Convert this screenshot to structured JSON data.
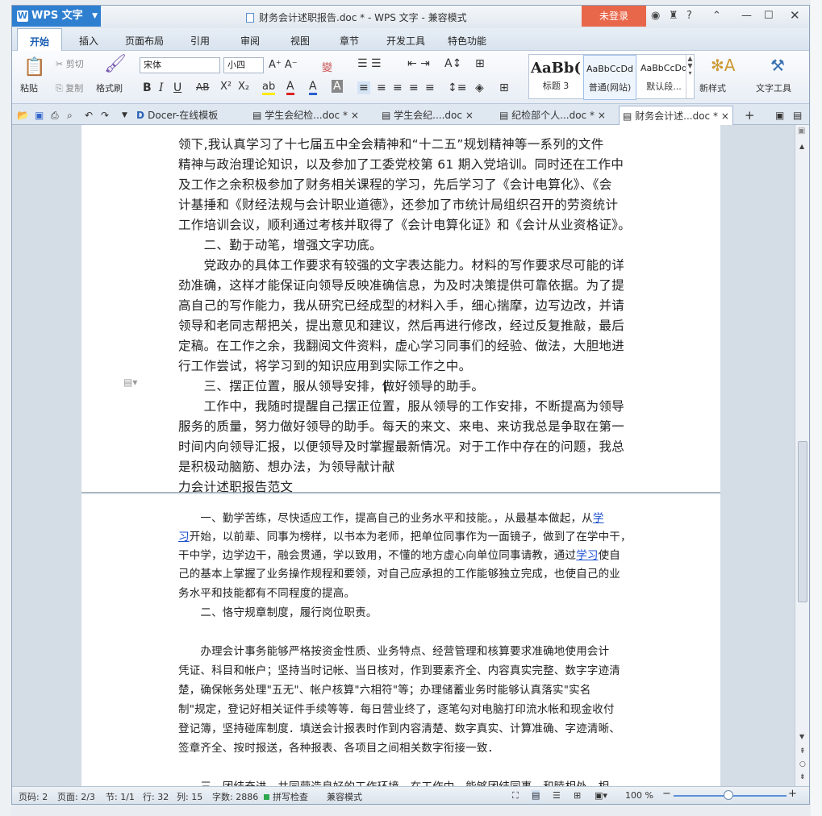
{
  "app": {
    "name": "WPS 文字",
    "doc_title": "财务会计述职报告.doc * - WPS 文字 - 兼容模式",
    "login_label": "未登录"
  },
  "menus": [
    "开始",
    "插入",
    "页面布局",
    "引用",
    "审阅",
    "视图",
    "章节",
    "开发工具",
    "特色功能"
  ],
  "ribbon": {
    "paste": "粘贴",
    "cut": "剪切",
    "copy": "复制",
    "format_painter": "格式刷",
    "font_name": "宋体",
    "font_size": "小四",
    "styles": [
      {
        "preview": "AaBb(",
        "label": "标题 3"
      },
      {
        "preview": "AaBbCcDd",
        "label": "普通(网站)"
      },
      {
        "preview": "AaBbCcDd",
        "label": "默认段..."
      }
    ],
    "new_style": "新样式",
    "text_tools": "文字工具"
  },
  "tabs": [
    {
      "label": "Docer-在线模板",
      "close": "×"
    },
    {
      "label": "学生会纪检...doc *",
      "close": "×"
    },
    {
      "label": "学生会纪....doc",
      "close": "×"
    },
    {
      "label": "纪检部个人...doc *",
      "close": "×"
    },
    {
      "label": "财务会计述...doc *",
      "close": "×"
    }
  ],
  "page1_lines": [
    "领下,我认真学习了十七届五中全会精神和“十二五”规划精神等一系列的文件",
    "精神与政治理论知识，以及参加了工委党校第 61 期入党培训。同时还在工作中",
    "及工作之余积极参加了财务相关课程的学习，先后学习了《会计电算化》、《会",
    "计基捶和《财经法规与会计职业道德》，还参加了市统计局组织召开的劳资统计",
    "工作培训会议，顺利通过考核并取得了《会计电算化证》和《会计从业资格证》。",
    "　　二、勤于动笔，增强文字功底。",
    "　　党政办的具体工作要求有较强的文字表达能力。材料的写作要求尽可能的详",
    "劲准确，这样才能保证向领导反映准确信息，为及时决策提供可靠依据。为了提",
    "高自己的写作能力，我从研究已经成型的材料入手，细心揣摩，边写边改，并请",
    "领导和老同志帮把关，提出意见和建议，然后再进行修改，经过反复推敲，最后",
    "定稿。在工作之余，我翻阅文件资料，虚心学习同事们的经验、做法，大胆地进",
    "行工作尝试，将学习到的知识应用到实际工作之中。",
    "　　三、摆正位置，服从领导安排，做好领导的助手。",
    "　　工作中，我随时提醒自己摆正位置，服从领导的工作安排，不断提高为领导",
    "服务的质量，努力做好领导的助手。每天的来文、来电、来访我总是争取在第一",
    "时间内向领导汇报，以便领导及时掌握最新情况。对于工作中存在的问题，我总",
    "是积极动脑筋、想办法，为领导献计献",
    "力会计述职报告范文"
  ],
  "page2": {
    "l1a": "　　一、勤学苦练，尽快适应工作，提高自己的业务水平和技能。，从最基本做起，从",
    "l1b": "学",
    "l2a": "习",
    "l2b": "开始，以前辈、同事为榜样，以书本为老师，把单位同事作为一面镜子，做到了在学中干，",
    "l3a": "干中学，边学边干，融会贯通，学以致用，不懂的地方虚心向单位同事请教，通过",
    "l3b": "学习",
    "l3c": "使自",
    "rest": [
      "己的基本上掌握了业务操作规程和要领，对自己应承担的工作能够独立完成，也使自己的业",
      "务水平和技能都有不同程度的提高。",
      "　　二、恪守规章制度，履行岗位职责。",
      "",
      "　　办理会计事务能够严格按资金性质、业务特点、经营管理和核算要求准确地使用会计",
      "凭证、科目和帐户；坚持当时记帐、当日核对，作到要素齐全、内容真实完整、数字字迹清",
      "楚，确保帐务处理\"五无\"、帐户核算\"六相符\"等；办理储蓄业务时能够认真落实\"实名",
      "制\"规定，登记好相关证件手续等等．每日营业终了，逐笔勾对电脑打印流水帐和现金收付",
      "登记簿，坚持碰库制度．填送会计报表时作到内容清楚、数字真实、计算准确、字迹清晰、",
      "签章齐全、按时报送，各种报表、各项目之间相关数字衔接一致．",
      "",
      "　　三、团结奋进，共同营造良好的工作环境。在工作中，能够团结同事，和睦相处，相"
    ]
  },
  "status": {
    "page_code": "页码: 2",
    "pages": "页面: 2/3",
    "section": "节: 1/1",
    "row": "行: 32",
    "col": "列: 15",
    "words": "字数: 2886",
    "spell": "拼写检查",
    "compat": "兼容模式",
    "zoom": "100 %"
  },
  "colors": {
    "accent": "#2f7fd1",
    "login": "#e8674a",
    "link": "#1a4fd1"
  }
}
